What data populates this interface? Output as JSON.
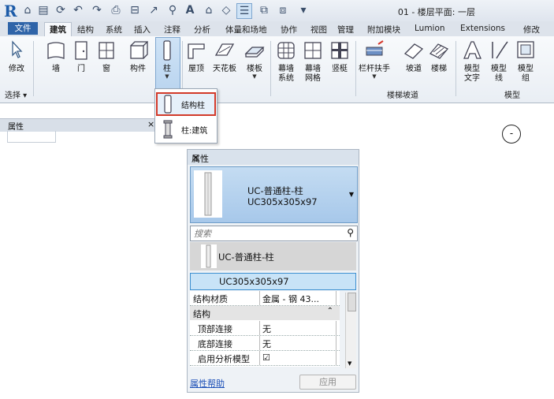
{
  "title_bar": {
    "title": "01 - 楼层平面: 一层"
  },
  "tabs": [
    "文件",
    "建筑",
    "结构",
    "系统",
    "插入",
    "注释",
    "分析",
    "体量和场地",
    "协作",
    "视图",
    "管理",
    "附加模块",
    "Lumion",
    "Extensions",
    "修改"
  ],
  "ribbon": {
    "buttons": {
      "modify": "修改",
      "wall": "墙",
      "door": "门",
      "window": "窗",
      "component": "构件",
      "column": "柱",
      "roof": "屋顶",
      "ceiling": "天花板",
      "floor": "楼板",
      "curtain_system": "幕墙\n系统",
      "curtain_grid": "幕墙\n网格",
      "mullion": "竖梃",
      "railing": "栏杆扶手",
      "ramp": "坡道",
      "stair": "楼梯",
      "model_text": "模型\n文字",
      "model_line": "模型\n线",
      "model_group": "模型\n组"
    },
    "groups": {
      "select": "选择 ▾",
      "circulation": "楼梯坡道",
      "model": "模型"
    }
  },
  "column_menu": {
    "structural": "结构柱",
    "architectural": "柱:建筑"
  },
  "properties_bg": {
    "label": "属性"
  },
  "circle_glyph": "-",
  "properties": {
    "title": "属性",
    "close": "×",
    "type_family": "UC-普通柱-柱",
    "type_name": "UC305x305x97",
    "search_placeholder": "搜索",
    "family_item": "UC-普通柱-柱",
    "type_item": "UC305x305x97",
    "rows": [
      {
        "key": "结构材质",
        "value": "金属 - 钢 43..."
      }
    ],
    "group_label": "结构",
    "group_rows": [
      {
        "key": "顶部连接",
        "value": "无"
      },
      {
        "key": "底部连接",
        "value": "无"
      },
      {
        "key": "启用分析模型",
        "value": "☑"
      }
    ],
    "help_link": "属性帮助",
    "apply_button": "应用"
  }
}
